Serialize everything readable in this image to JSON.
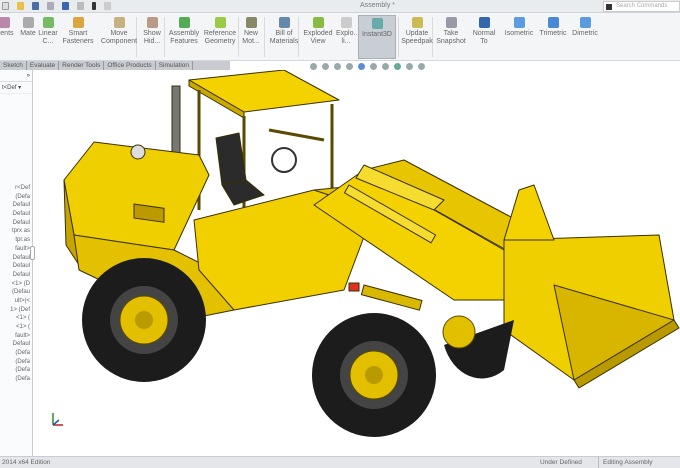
{
  "title_bar": {
    "document_title": "Assembly *",
    "search_placeholder": "Search Commands"
  },
  "ribbon": {
    "buttons": [
      {
        "label": "...ents",
        "icon": "component-icon"
      },
      {
        "label": "Mate",
        "icon": "mate-icon"
      },
      {
        "label": "Linear C...",
        "icon": "linear-pattern-icon"
      },
      {
        "label": "Smart Fasteners",
        "icon": "smart-fasteners-icon"
      },
      {
        "label": "Move Component",
        "icon": "move-component-icon"
      },
      {
        "label": "Show Hid...",
        "icon": "show-hidden-icon"
      },
      {
        "label": "Assembly Features",
        "icon": "assembly-features-icon"
      },
      {
        "label": "Reference Geometry",
        "icon": "reference-geometry-icon"
      },
      {
        "label": "New Mot...",
        "icon": "new-motion-study-icon"
      },
      {
        "label": "Bill of Materials",
        "icon": "bill-of-materials-icon"
      },
      {
        "label": "Exploded View",
        "icon": "exploded-view-icon"
      },
      {
        "label": "Explo... li...",
        "icon": "explode-line-icon"
      },
      {
        "label": "Instant3D",
        "icon": "instant3d-icon"
      },
      {
        "label": "Update Speedpak",
        "icon": "update-speedpak-icon"
      },
      {
        "label": "Take Snapshot",
        "icon": "snapshot-icon"
      },
      {
        "label": "Normal To",
        "icon": "normal-to-icon"
      },
      {
        "label": "Isometric",
        "icon": "isometric-icon"
      },
      {
        "label": "Trimetric",
        "icon": "trimetric-icon"
      },
      {
        "label": "Dimetric",
        "icon": "dimetric-icon"
      }
    ]
  },
  "tabs": [
    "Sketch",
    "Evaluate",
    "Render Tools",
    "Office Products",
    "Simulation"
  ],
  "feature_tree": {
    "config": "t<Def",
    "items": [
      "r<Def",
      "(Defa",
      "Defaul",
      "Defaul",
      "Defaul",
      "tprx as",
      "tpr.as",
      "fault>",
      "Defaul",
      "Defaul",
      "Defaul",
      "<1> (D",
      "(Defau",
      "ult>(<",
      "1> (Def",
      "<1> (",
      "<1> (",
      "fault>",
      "Defaul",
      "(Defa",
      "(Defa",
      "(Defa",
      "(Defa"
    ]
  },
  "status_bar": {
    "edition": "2014 x64 Edition",
    "state": "Under Defined",
    "mode": "Editing Assembly"
  },
  "colors": {
    "machine_yellow": "#f0cf00",
    "tire": "#1c1c1c",
    "highlight": "#c9ced4"
  }
}
